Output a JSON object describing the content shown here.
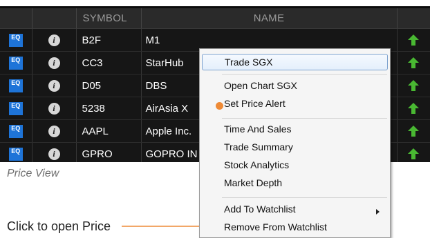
{
  "table": {
    "headers": [
      "",
      "",
      "SYMBOL",
      "NAME",
      ""
    ],
    "rows": [
      {
        "type": "EQ",
        "symbol": "B2F",
        "name": "M1"
      },
      {
        "type": "EQ",
        "symbol": "CC3",
        "name": "StarHub"
      },
      {
        "type": "EQ",
        "symbol": "D05",
        "name": "DBS"
      },
      {
        "type": "EQ",
        "symbol": "5238",
        "name": "AirAsia X"
      },
      {
        "type": "EQ",
        "symbol": "AAPL",
        "name": "Apple Inc."
      },
      {
        "type": "EQ",
        "symbol": "GPRO",
        "name": "GOPRO IN"
      }
    ],
    "info_glyph": "i",
    "direction_icon": "up-arrow-icon",
    "colors": {
      "eq_badge": "#1e74d8",
      "up_arrow": "#49b832",
      "callout": "#ee8a36"
    }
  },
  "caption": "Price View",
  "callout": "Click to open Price",
  "context_menu": {
    "items": [
      {
        "label": "Trade SGX",
        "highlighted": true
      },
      {
        "label": "Open Chart SGX"
      },
      {
        "label": "Set Price Alert"
      },
      {
        "label": "Time And Sales"
      },
      {
        "label": "Trade Summary"
      },
      {
        "label": "Stock Analytics"
      },
      {
        "label": "Market Depth"
      },
      {
        "label": "Add To Watchlist",
        "has_submenu": true
      },
      {
        "label": "Remove From Watchlist"
      }
    ]
  }
}
